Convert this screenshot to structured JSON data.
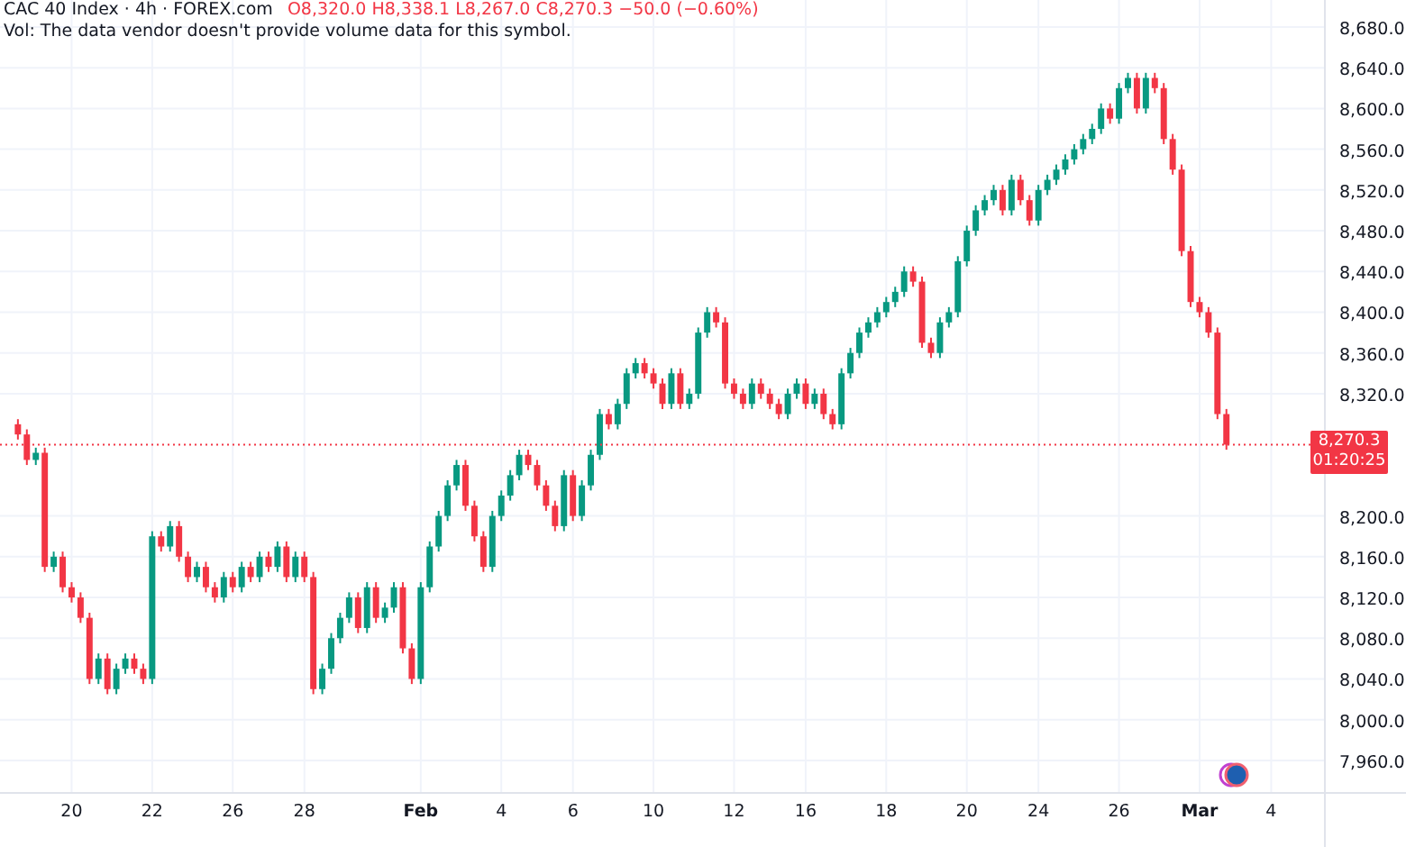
{
  "legend": {
    "symbol": "CAC 40 Index · 4h · FOREX.com",
    "ohlc": "O8,320.0 H8,338.1 L8,267.0 C8,270.3 −50.0 (−0.60%)",
    "volume_note": "Vol: The data vendor doesn't provide volume data for this symbol."
  },
  "chart": {
    "chart_data": {
      "type": "candlestick",
      "grid": true,
      "ylim": [
        7875,
        8706.5
      ],
      "yticks": [
        {
          "value": 7960,
          "label": "7,960.0"
        },
        {
          "value": 8000,
          "label": "8,000.0"
        },
        {
          "value": 8040,
          "label": "8,040.0"
        },
        {
          "value": 8080,
          "label": "8,080.0"
        },
        {
          "value": 8120,
          "label": "8,120.0"
        },
        {
          "value": 8160,
          "label": "8,160.0"
        },
        {
          "value": 8200,
          "label": "8,200.0"
        },
        {
          "value": 8320,
          "label": "8,320.0"
        },
        {
          "value": 8360,
          "label": "8,360.0"
        },
        {
          "value": 8400,
          "label": "8,400.0"
        },
        {
          "value": 8440,
          "label": "8,440.0"
        },
        {
          "value": 8480,
          "label": "8,480.0"
        },
        {
          "value": 8520,
          "label": "8,520.0"
        },
        {
          "value": 8560,
          "label": "8,560.0"
        },
        {
          "value": 8600,
          "label": "8,600.0"
        },
        {
          "value": 8640,
          "label": "8,640.0"
        },
        {
          "value": 8680,
          "label": "8,680.0"
        }
      ],
      "ref_lines": [
        {
          "axis": "y",
          "value": 8270,
          "color": "#f23645"
        }
      ],
      "categories": [
        null,
        null,
        null,
        null,
        null,
        null,
        "20",
        null,
        null,
        null,
        null,
        null,
        null,
        null,
        null,
        "22",
        null,
        null,
        null,
        null,
        null,
        null,
        null,
        null,
        "26",
        null,
        null,
        null,
        null,
        null,
        null,
        null,
        "28",
        null,
        null,
        null,
        null,
        null,
        null,
        null,
        null,
        null,
        null,
        null,
        null,
        "Feb",
        null,
        null,
        null,
        null,
        null,
        null,
        null,
        null,
        "4",
        null,
        null,
        null,
        null,
        null,
        null,
        null,
        "6",
        null,
        null,
        null,
        null,
        null,
        null,
        null,
        null,
        "10",
        null,
        null,
        null,
        null,
        null,
        null,
        null,
        null,
        "12",
        null,
        null,
        null,
        null,
        null,
        null,
        null,
        "16",
        null,
        null,
        null,
        null,
        null,
        null,
        null,
        null,
        "18",
        null,
        null,
        null,
        null,
        null,
        null,
        null,
        null,
        "20",
        null,
        null,
        null,
        null,
        null,
        null,
        null,
        "24",
        null,
        null,
        null,
        null,
        null,
        null,
        null,
        null,
        "26",
        null,
        null,
        null,
        null,
        null,
        null,
        null,
        null,
        "Mar",
        null,
        null,
        null,
        null,
        null,
        null,
        null,
        "4"
      ],
      "ohlc": [
        [
          8290,
          8295,
          8275,
          8280
        ],
        [
          8280,
          8285,
          8250,
          8255
        ],
        [
          8255,
          8267,
          8250,
          8262
        ],
        [
          8262,
          8267,
          8145,
          8150
        ],
        [
          8150,
          8165,
          8145,
          8160
        ],
        [
          8160,
          8165,
          8125,
          8130
        ],
        [
          8130,
          8135,
          8115,
          8120
        ],
        [
          8120,
          8125,
          8095,
          8100
        ],
        [
          8100,
          8105,
          8035,
          8040
        ],
        [
          8040,
          8065,
          8035,
          8060
        ],
        [
          8060,
          8065,
          8025,
          8030
        ],
        [
          8030,
          8055,
          8025,
          8050
        ],
        [
          8050,
          8065,
          8045,
          8060
        ],
        [
          8060,
          8065,
          8045,
          8050
        ],
        [
          8050,
          8055,
          8035,
          8040
        ],
        [
          8040,
          8185,
          8035,
          8180
        ],
        [
          8180,
          8185,
          8165,
          8170
        ],
        [
          8170,
          8195,
          8165,
          8190
        ],
        [
          8190,
          8195,
          8155,
          8160
        ],
        [
          8160,
          8165,
          8135,
          8140
        ],
        [
          8140,
          8155,
          8135,
          8150
        ],
        [
          8150,
          8155,
          8125,
          8130
        ],
        [
          8130,
          8135,
          8115,
          8120
        ],
        [
          8120,
          8145,
          8115,
          8140
        ],
        [
          8140,
          8145,
          8125,
          8130
        ],
        [
          8130,
          8155,
          8125,
          8150
        ],
        [
          8150,
          8155,
          8135,
          8140
        ],
        [
          8140,
          8165,
          8135,
          8160
        ],
        [
          8160,
          8165,
          8145,
          8150
        ],
        [
          8150,
          8175,
          8145,
          8170
        ],
        [
          8170,
          8175,
          8135,
          8140
        ],
        [
          8140,
          8165,
          8135,
          8160
        ],
        [
          8160,
          8165,
          8135,
          8140
        ],
        [
          8140,
          8145,
          8025,
          8030
        ],
        [
          8030,
          8055,
          8025,
          8050
        ],
        [
          8050,
          8085,
          8045,
          8080
        ],
        [
          8080,
          8105,
          8075,
          8100
        ],
        [
          8100,
          8125,
          8095,
          8120
        ],
        [
          8120,
          8125,
          8085,
          8090
        ],
        [
          8090,
          8135,
          8085,
          8130
        ],
        [
          8130,
          8135,
          8095,
          8100
        ],
        [
          8100,
          8115,
          8095,
          8110
        ],
        [
          8110,
          8135,
          8105,
          8130
        ],
        [
          8130,
          8135,
          8065,
          8070
        ],
        [
          8070,
          8075,
          8035,
          8040
        ],
        [
          8040,
          8135,
          8035,
          8130
        ],
        [
          8130,
          8175,
          8125,
          8170
        ],
        [
          8170,
          8205,
          8165,
          8200
        ],
        [
          8200,
          8235,
          8195,
          8230
        ],
        [
          8230,
          8255,
          8225,
          8250
        ],
        [
          8250,
          8255,
          8205,
          8210
        ],
        [
          8210,
          8215,
          8175,
          8180
        ],
        [
          8180,
          8185,
          8145,
          8150
        ],
        [
          8150,
          8205,
          8145,
          8200
        ],
        [
          8200,
          8225,
          8195,
          8220
        ],
        [
          8220,
          8245,
          8215,
          8240
        ],
        [
          8240,
          8265,
          8235,
          8260
        ],
        [
          8260,
          8265,
          8245,
          8250
        ],
        [
          8250,
          8255,
          8225,
          8230
        ],
        [
          8230,
          8235,
          8205,
          8210
        ],
        [
          8210,
          8215,
          8185,
          8190
        ],
        [
          8190,
          8245,
          8185,
          8240
        ],
        [
          8240,
          8245,
          8195,
          8200
        ],
        [
          8200,
          8235,
          8195,
          8230
        ],
        [
          8230,
          8265,
          8225,
          8260
        ],
        [
          8260,
          8305,
          8255,
          8300
        ],
        [
          8300,
          8305,
          8285,
          8290
        ],
        [
          8290,
          8315,
          8285,
          8310
        ],
        [
          8310,
          8345,
          8305,
          8340
        ],
        [
          8340,
          8355,
          8335,
          8350
        ],
        [
          8350,
          8355,
          8335,
          8340
        ],
        [
          8340,
          8345,
          8325,
          8330
        ],
        [
          8330,
          8335,
          8305,
          8310
        ],
        [
          8310,
          8345,
          8305,
          8340
        ],
        [
          8340,
          8345,
          8305,
          8310
        ],
        [
          8310,
          8325,
          8305,
          8320
        ],
        [
          8320,
          8385,
          8315,
          8380
        ],
        [
          8380,
          8405,
          8375,
          8400
        ],
        [
          8400,
          8405,
          8385,
          8390
        ],
        [
          8390,
          8395,
          8325,
          8330
        ],
        [
          8330,
          8335,
          8315,
          8320
        ],
        [
          8320,
          8325,
          8305,
          8310
        ],
        [
          8310,
          8335,
          8305,
          8330
        ],
        [
          8330,
          8335,
          8315,
          8320
        ],
        [
          8320,
          8325,
          8305,
          8310
        ],
        [
          8310,
          8315,
          8295,
          8300
        ],
        [
          8300,
          8325,
          8295,
          8320
        ],
        [
          8320,
          8335,
          8315,
          8330
        ],
        [
          8330,
          8335,
          8305,
          8310
        ],
        [
          8310,
          8325,
          8305,
          8320
        ],
        [
          8320,
          8325,
          8295,
          8300
        ],
        [
          8300,
          8305,
          8285,
          8290
        ],
        [
          8290,
          8345,
          8285,
          8340
        ],
        [
          8340,
          8365,
          8335,
          8360
        ],
        [
          8360,
          8385,
          8355,
          8380
        ],
        [
          8380,
          8395,
          8375,
          8390
        ],
        [
          8390,
          8405,
          8385,
          8400
        ],
        [
          8400,
          8415,
          8395,
          8410
        ],
        [
          8410,
          8425,
          8405,
          8420
        ],
        [
          8420,
          8445,
          8415,
          8440
        ],
        [
          8440,
          8445,
          8425,
          8430
        ],
        [
          8430,
          8435,
          8365,
          8370
        ],
        [
          8370,
          8375,
          8355,
          8360
        ],
        [
          8360,
          8395,
          8355,
          8390
        ],
        [
          8390,
          8405,
          8385,
          8400
        ],
        [
          8400,
          8455,
          8395,
          8450
        ],
        [
          8450,
          8485,
          8445,
          8480
        ],
        [
          8480,
          8505,
          8475,
          8500
        ],
        [
          8500,
          8515,
          8495,
          8510
        ],
        [
          8510,
          8525,
          8505,
          8520
        ],
        [
          8520,
          8525,
          8495,
          8500
        ],
        [
          8500,
          8535,
          8495,
          8530
        ],
        [
          8530,
          8535,
          8505,
          8510
        ],
        [
          8510,
          8515,
          8485,
          8490
        ],
        [
          8490,
          8525,
          8485,
          8520
        ],
        [
          8520,
          8535,
          8515,
          8530
        ],
        [
          8530,
          8545,
          8525,
          8540
        ],
        [
          8540,
          8555,
          8535,
          8550
        ],
        [
          8550,
          8565,
          8545,
          8560
        ],
        [
          8560,
          8575,
          8555,
          8570
        ],
        [
          8570,
          8585,
          8565,
          8580
        ],
        [
          8580,
          8605,
          8575,
          8600
        ],
        [
          8600,
          8605,
          8585,
          8590
        ],
        [
          8590,
          8625,
          8585,
          8620
        ],
        [
          8620,
          8635,
          8615,
          8630
        ],
        [
          8630,
          8635,
          8595,
          8600
        ],
        [
          8600,
          8635,
          8595,
          8630
        ],
        [
          8630,
          8635,
          8615,
          8620
        ],
        [
          8620,
          8625,
          8565,
          8570
        ],
        [
          8570,
          8575,
          8535,
          8540
        ],
        [
          8540,
          8545,
          8455,
          8460
        ],
        [
          8460,
          8465,
          8405,
          8410
        ],
        [
          8410,
          8415,
          8395,
          8400
        ],
        [
          8400,
          8405,
          8375,
          8380
        ],
        [
          8380,
          8385,
          8295,
          8300
        ],
        [
          8300,
          8305,
          8265,
          8270
        ],
        null,
        null,
        null,
        null,
        null
      ]
    },
    "last_price": {
      "price": "8,270.3",
      "countdown": "01:20:25"
    }
  }
}
